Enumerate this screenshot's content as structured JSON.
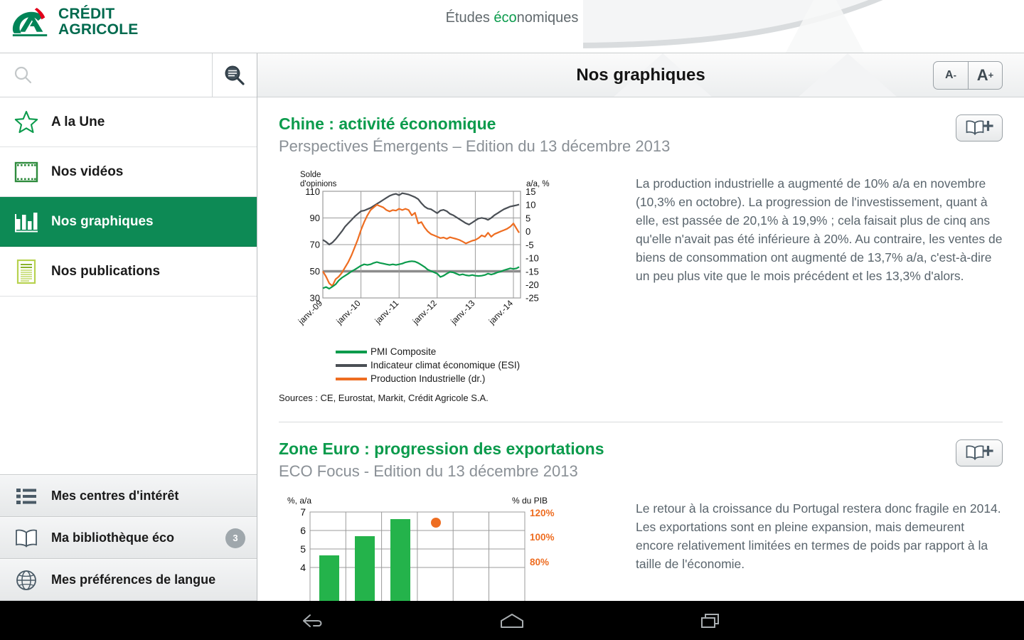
{
  "brand": {
    "logo_text_line1": "CRÉDIT",
    "logo_text_line2": "AGRICOLE",
    "title_prefix": "Études ",
    "title_accent": "éco",
    "title_suffix": "nomiques",
    "green": "#0b9b4c",
    "dark_green": "#006a4e",
    "gray": "#61696d"
  },
  "sidebar": {
    "search": {
      "value": "",
      "placeholder": ""
    },
    "search_icon": "search-icon",
    "advanced_search_icon": "advanced-search-icon",
    "items": [
      {
        "label": "A la Une",
        "icon": "star-icon",
        "active": false
      },
      {
        "label": "Nos vidéos",
        "icon": "film-icon",
        "active": false
      },
      {
        "label": "Nos graphiques",
        "icon": "bar-chart-icon",
        "active": true
      },
      {
        "label": "Nos publications",
        "icon": "document-icon",
        "active": false
      }
    ],
    "bottom_items": [
      {
        "label": "Mes centres d'intérêt",
        "icon": "list-icon",
        "badge": ""
      },
      {
        "label": "Ma bibliothèque éco",
        "icon": "book-icon",
        "badge": "3"
      },
      {
        "label": "Mes préférences de langue",
        "icon": "globe-icon",
        "badge": ""
      }
    ]
  },
  "content": {
    "header_title": "Nos graphiques",
    "font_decrease_label": "A",
    "font_decrease_sup": "-",
    "font_increase_label": "A",
    "font_increase_sup": "+",
    "bookmark_icon": "add-to-library-icon"
  },
  "articles": [
    {
      "title": "Chine : activité économique",
      "subtitle": "Perspectives Émergents – Edition du 13 décembre 2013",
      "text": "La production industrielle a augmenté de 10% a/a en novembre (10,3% en octobre). La progression de l'investissement, quant à elle, est passée de 20,1% à 19,9% ; cela faisait plus de cinq ans qu'elle n'avait pas été inférieure à 20%. Au contraire, les ventes de biens de consommation ont augmenté de 13,7% a/a, c'est-à-dire un peu plus vite que le mois précédent et les 13,3% d'alors.",
      "source": "Sources : CE, Eurostat, Markit, Crédit Agricole S.A."
    },
    {
      "title": "Zone Euro : progression des exportations",
      "subtitle": "ECO Focus - Edition du 13 décembre 2013",
      "text": "Le retour à la croissance du Portugal restera donc fragile en 2014. Les exportations sont en pleine expansion, mais demeurent encore relativement limitées en termes de poids par rapport à la taille de l'économie."
    }
  ],
  "chart_data": [
    {
      "type": "line",
      "title": "",
      "ylabel": "Solde d'opinions",
      "ylabel2": "a/a, %",
      "xlabel": "",
      "categories": [
        "janv.-09",
        "janv.-10",
        "janv.-11",
        "janv.-12",
        "janv.-13",
        "janv.-14"
      ],
      "ylim": [
        30,
        110
      ],
      "yticks": [
        30,
        50,
        70,
        90,
        110
      ],
      "ylim2": [
        -25,
        15
      ],
      "yticks2": [
        -25,
        -20,
        -15,
        -10,
        -5,
        0,
        5,
        10,
        15
      ],
      "grid": true,
      "legend": [
        "PMI Composite",
        "Indicateur climat économique (ESI)",
        "Production Industrielle (dr.)"
      ],
      "legend_position": "bottom",
      "series": [
        {
          "name": "PMI Composite",
          "color": "#0b9b4c",
          "axis": "left",
          "values": [
            37.5,
            38.5,
            37.2,
            38.8,
            40.5,
            43.5,
            45.5,
            47.0,
            48.5,
            50.2,
            51.5,
            53.0,
            54.5,
            55.5,
            55.0,
            55.5,
            56.5,
            57.2,
            56.5,
            56.0,
            55.5,
            55.0,
            55.5,
            55.0,
            55.5,
            56.0,
            57.0,
            57.5,
            57.8,
            57.5,
            56.5,
            55.0,
            53.5,
            51.5,
            50.5,
            49.5,
            48.5,
            46.0,
            47.0,
            48.5,
            49.8,
            49.5,
            48.5,
            47.5,
            48.0,
            47.3,
            47.0,
            47.5,
            47.0,
            46.8,
            47.0,
            47.5,
            48.5,
            47.8,
            48.5,
            49.5,
            50.0,
            51.0,
            51.8,
            52.5,
            52.0,
            52.5,
            53.5
          ]
        },
        {
          "name": "Indicateur climat économique (ESI)",
          "color": "#4a4f55",
          "axis": "left",
          "values": [
            73.5,
            72.0,
            70.0,
            71.5,
            74.0,
            77.0,
            80.0,
            83.5,
            86.0,
            88.5,
            91.0,
            93.0,
            95.0,
            95.5,
            96.5,
            97.5,
            99.0,
            100.5,
            102.0,
            103.5,
            105.0,
            106.5,
            107.5,
            108.0,
            107.0,
            108.5,
            108.0,
            107.5,
            106.5,
            105.5,
            104.0,
            101.0,
            98.5,
            97.0,
            96.5,
            95.0,
            93.5,
            95.5,
            96.0,
            95.0,
            93.0,
            92.0,
            90.5,
            89.0,
            87.5,
            86.0,
            85.0,
            86.5,
            88.0,
            89.5,
            90.0,
            89.5,
            88.5,
            90.0,
            92.0,
            93.5,
            95.0,
            96.5,
            97.5,
            98.5,
            99.5,
            100.5,
            101.0
          ]
        },
        {
          "name": "Production Industrielle (dr.)",
          "color": "#ee6d21",
          "axis": "right",
          "values": [
            -15.0,
            -17.0,
            -19.5,
            -20.5,
            -18.0,
            -17.0,
            -15.5,
            -13.5,
            -11.5,
            -9.0,
            -6.0,
            -3.0,
            0.5,
            3.5,
            6.0,
            8.0,
            9.0,
            10.0,
            9.5,
            9.0,
            8.0,
            7.5,
            8.0,
            7.8,
            8.5,
            8.0,
            8.5,
            8.0,
            6.0,
            7.0,
            3.0,
            3.5,
            1.5,
            0.0,
            -1.0,
            -1.5,
            -2.0,
            -2.5,
            -2.3,
            -2.8,
            -2.2,
            -2.5,
            -2.8,
            -3.2,
            -3.8,
            -4.5,
            -4.0,
            -3.5,
            -3.2,
            -2.5,
            -1.5,
            -2.0,
            -0.5,
            -2.0,
            -1.0,
            -0.5,
            0.0,
            0.5,
            1.0,
            1.8,
            3.0,
            1.0,
            -0.5
          ]
        }
      ]
    },
    {
      "type": "bar",
      "title": "",
      "ylabel": "%, a/a",
      "ylabel2": "% du PIB",
      "ylim": [
        3,
        7
      ],
      "yticks": [
        4,
        5,
        6,
        7
      ],
      "yticks2": [
        "80%",
        "100%",
        "120%"
      ],
      "grid": true,
      "bar_color": "#24b34b",
      "marker_color": "#ee6d21",
      "categories": [
        "",
        "",
        "",
        "",
        "",
        ""
      ],
      "values": [
        4.65,
        5.68,
        6.6,
        null,
        null,
        null
      ],
      "marker_values": [
        null,
        null,
        null,
        6.4,
        null,
        null
      ]
    }
  ],
  "androidbar": {
    "back_icon": "back-icon",
    "home_icon": "home-icon",
    "recents_icon": "recent-apps-icon"
  }
}
